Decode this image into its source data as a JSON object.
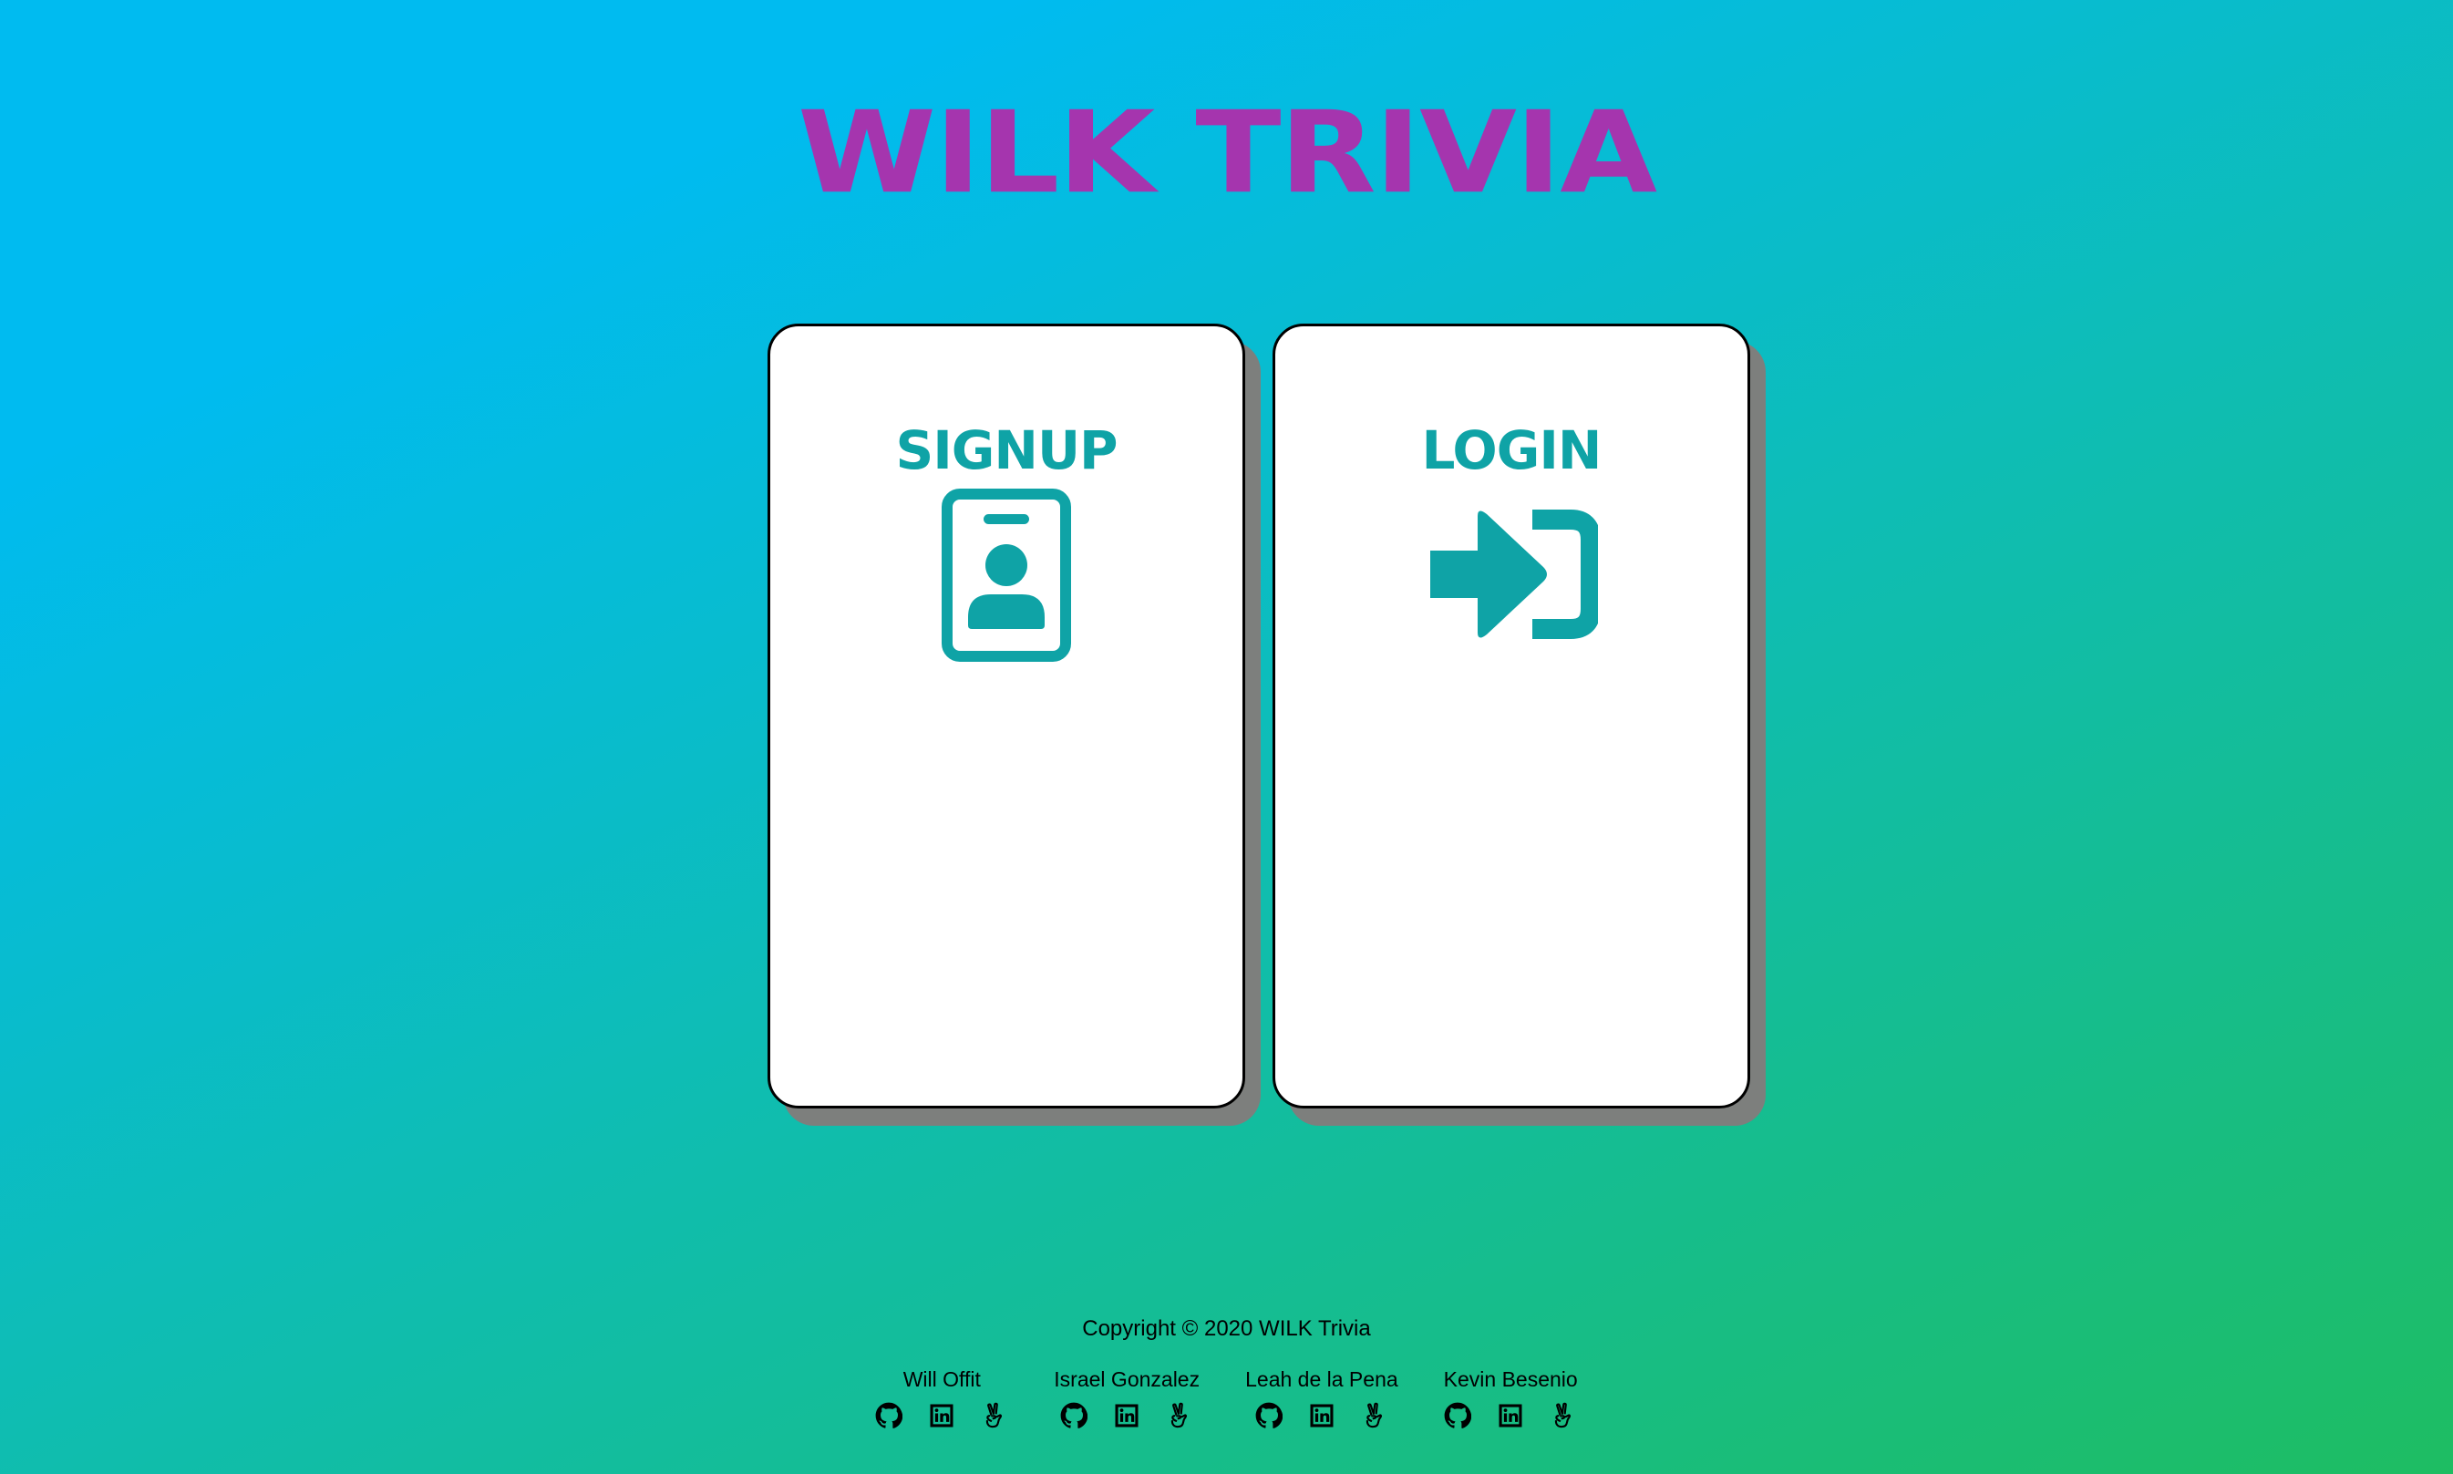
{
  "header": {
    "title": "WILK TRIVIA"
  },
  "cards": {
    "signup": {
      "label": "Signup",
      "icon": "id-badge-icon"
    },
    "login": {
      "label": "Login",
      "icon": "sign-in-arrow-icon"
    }
  },
  "footer": {
    "copyright": "Copyright © 2020 WILK Trivia",
    "members": [
      {
        "name": "Will Offit",
        "links": [
          "github-icon",
          "linkedin-icon",
          "angellist-icon"
        ]
      },
      {
        "name": "Israel Gonzalez",
        "links": [
          "github-icon",
          "linkedin-icon",
          "angellist-icon"
        ]
      },
      {
        "name": "Leah de la Pena",
        "links": [
          "github-icon",
          "linkedin-icon",
          "angellist-icon"
        ]
      },
      {
        "name": "Kevin Besenio",
        "links": [
          "github-icon",
          "linkedin-icon",
          "angellist-icon"
        ]
      }
    ]
  },
  "colors": {
    "title": "#a535ae",
    "accent": "#0fa3a6",
    "gradient_start": "#00bbf0",
    "gradient_end": "#1ebd62",
    "card_shadow": "#7d7f7d"
  }
}
